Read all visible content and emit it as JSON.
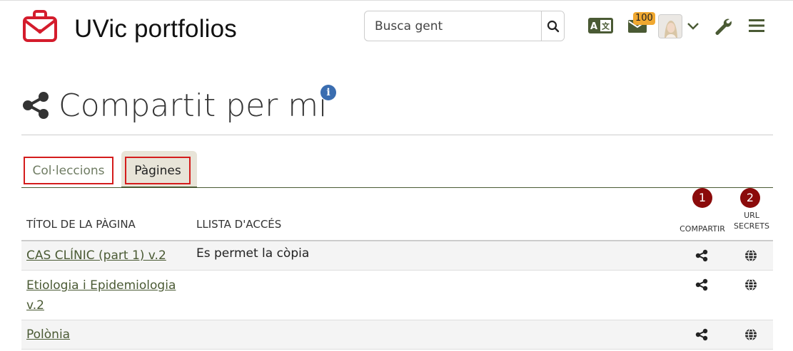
{
  "header": {
    "site_title": "UVic portfolios",
    "search_placeholder": "Busca gent",
    "mail_count": "100",
    "brand_color": "#d41c2c",
    "accent_color": "#4a5a34"
  },
  "page": {
    "title": "Compartit per mi"
  },
  "tabs": [
    {
      "label": "Col·leccions",
      "active": false
    },
    {
      "label": "Pàgines",
      "active": true
    }
  ],
  "table": {
    "headers": {
      "title": "TÍTOL DE LA PÀGINA",
      "access": "LLISTA D'ACCÉS",
      "share": "COMPARTIR",
      "url_line1": "URL",
      "url_line2": "SECRETS"
    },
    "badges": [
      "1",
      "2"
    ],
    "rows": [
      {
        "title": "CAS CLÍNIC (part 1) v.2",
        "access": "Es permet la còpia"
      },
      {
        "title": "Etiologia i Epidemiologia v.2",
        "access": ""
      },
      {
        "title": "Polònia",
        "access": ""
      }
    ]
  }
}
